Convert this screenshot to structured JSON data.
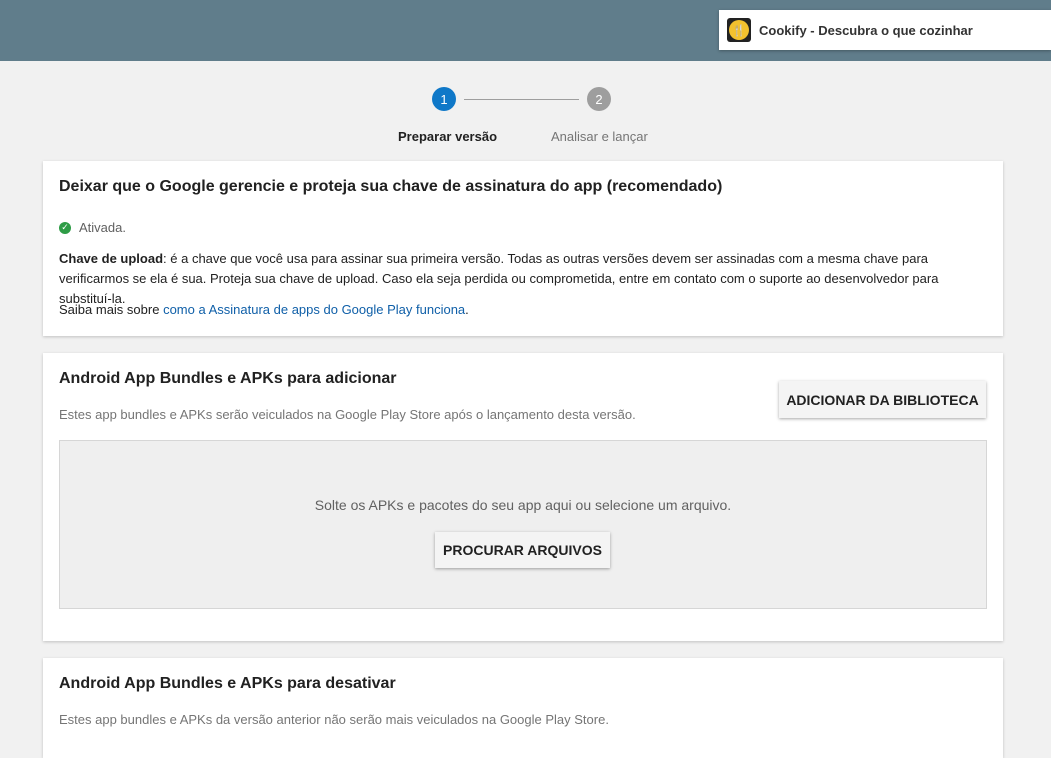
{
  "app": {
    "name": "Cookify - Descubra o que cozinhar"
  },
  "stepper": {
    "steps": [
      {
        "number": "1",
        "label": "Preparar versão",
        "active": true
      },
      {
        "number": "2",
        "label": "Analisar e lançar",
        "active": false
      }
    ]
  },
  "signing_card": {
    "title": "Deixar que o Google gerencie e proteja sua chave de assinatura do app (recomendado)",
    "status": "Ativada.",
    "upload_key_label": "Chave de upload",
    "upload_key_text": ": é a chave que você usa para assinar sua primeira versão. Todas as outras versões devem ser assinadas com a mesma chave para verificarmos se ela é sua. Proteja sua chave de upload. Caso ela seja perdida ou comprometida, entre em contato com o suporte ao desenvolvedor para substituí-la.",
    "learn_more_prefix": "Saiba mais sobre ",
    "learn_more_link": "como a Assinatura de apps do Google Play funciona",
    "learn_more_suffix": "."
  },
  "add_card": {
    "title": "Android App Bundles e APKs para adicionar",
    "description": "Estes app bundles e APKs serão veiculados na Google Play Store após o lançamento desta versão.",
    "library_button": "ADICIONAR DA BIBLIOTECA",
    "drop_text": "Solte os APKs e pacotes do seu app aqui ou selecione um arquivo.",
    "browse_button": "PROCURAR ARQUIVOS"
  },
  "deactivate_card": {
    "title": "Android App Bundles e APKs para desativar",
    "description": "Estes app bundles e APKs da versão anterior não serão mais veiculados na Google Play Store."
  },
  "colors": {
    "topbar": "#607d8b",
    "accent": "#0f78c8",
    "success": "#2e9c46",
    "link": "#0f5fa8"
  }
}
